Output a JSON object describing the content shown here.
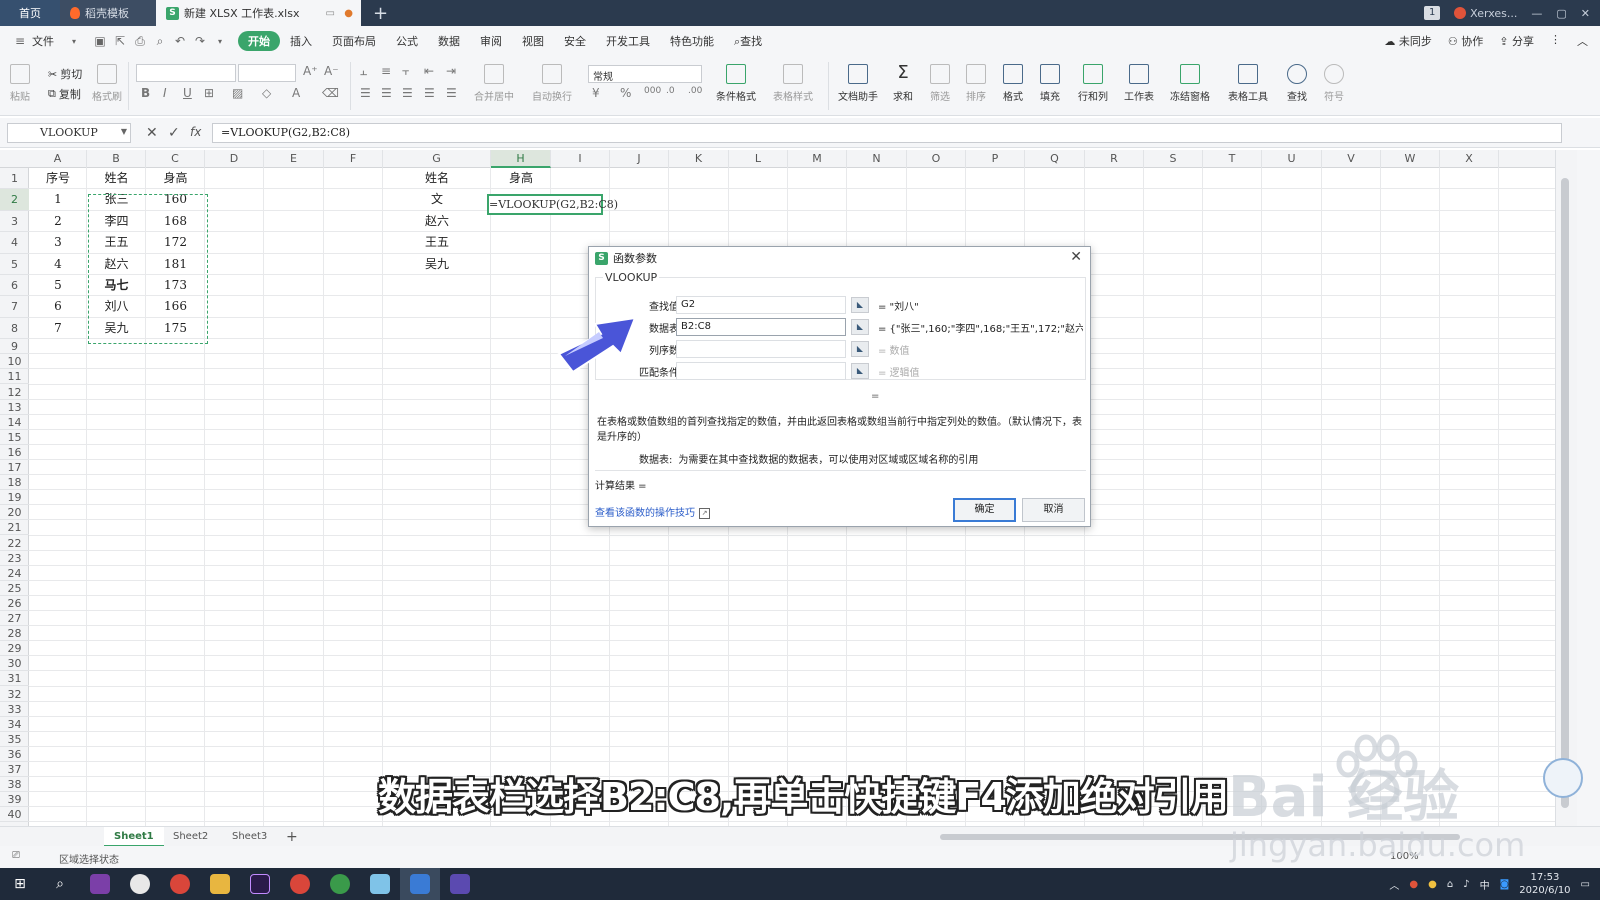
{
  "tabs": {
    "home": "首页",
    "template": "稻壳模板",
    "active_file": "新建 XLSX 工作表.xlsx",
    "badge_count": "1",
    "user_name": "Xerxes..."
  },
  "menu": {
    "file": "文件",
    "items": [
      "开始",
      "插入",
      "页面布局",
      "公式",
      "数据",
      "审阅",
      "视图",
      "安全",
      "开发工具",
      "特色功能"
    ],
    "search": "查找",
    "unsync": "未同步",
    "collab": "协作",
    "share": "分享"
  },
  "ribbon": {
    "paste": "粘贴",
    "cut": "剪切",
    "copy": "复制",
    "format_painter": "格式刷",
    "number_format": "常规",
    "merge_center": "合并居中",
    "wrap": "自动换行",
    "cond_format": "条件格式",
    "table_style": "表格样式",
    "doc_helper": "文档助手",
    "sum": "求和",
    "filter": "筛选",
    "sort": "排序",
    "format": "格式",
    "fill": "填充",
    "row_col": "行和列",
    "worksheet": "工作表",
    "freeze": "冻结窗格",
    "table_tools": "表格工具",
    "find": "查找",
    "symbol": "符号"
  },
  "formula_bar": {
    "name_box": "VLOOKUP",
    "formula": "=VLOOKUP(G2,B2:C8)"
  },
  "grid": {
    "columns": [
      "A",
      "B",
      "C",
      "D",
      "E",
      "F",
      "G",
      "H",
      "I",
      "J",
      "K",
      "L",
      "M",
      "N",
      "O",
      "P",
      "Q",
      "R",
      "S",
      "T",
      "U",
      "V",
      "W",
      "X"
    ],
    "rows": [
      "1",
      "2",
      "3",
      "4",
      "5",
      "6",
      "7",
      "8",
      "9",
      "10",
      "11",
      "12",
      "13",
      "14",
      "15",
      "16",
      "17",
      "18",
      "19",
      "20",
      "21",
      "22",
      "23",
      "24",
      "25",
      "26",
      "27",
      "28",
      "29",
      "30",
      "31",
      "32",
      "33",
      "34",
      "35",
      "36",
      "37",
      "38",
      "39",
      "40"
    ],
    "table_headers": [
      "序号",
      "姓名",
      "身高"
    ],
    "table_rows": [
      [
        "1",
        "张三",
        "160"
      ],
      [
        "2",
        "李四",
        "168"
      ],
      [
        "3",
        "王五",
        "172"
      ],
      [
        "4",
        "赵六",
        "181"
      ],
      [
        "5",
        "马七",
        "173"
      ],
      [
        "6",
        "刘八",
        "166"
      ],
      [
        "7",
        "吴九",
        "175"
      ]
    ],
    "lookup_header_name": "姓名",
    "lookup_header_height": "身高",
    "lookup_names": [
      "文",
      "赵六",
      "王五",
      "吴九"
    ],
    "edit_cell_text": "=VLOOKUP(G2,B2:C8)"
  },
  "sheets": [
    "Sheet1",
    "Sheet2",
    "Sheet3"
  ],
  "status": {
    "mode": "区域选择状态",
    "zoom": "100%"
  },
  "dialog": {
    "title": "函数参数",
    "function_name": "VLOOKUP",
    "args": [
      {
        "label": "查找值",
        "value": "G2",
        "result": "= \"刘八\""
      },
      {
        "label": "数据表",
        "value": "B2:C8",
        "result": "= {\"张三\",160;\"李四\",168;\"王五\",172;\"赵六..."
      },
      {
        "label": "列序数",
        "value": "",
        "result": "= 数值"
      },
      {
        "label": "匹配条件",
        "value": "",
        "result": "= 逻辑值"
      }
    ],
    "equals": "=",
    "description": "在表格或数值数组的首列查找指定的数值，并由此返回表格或数组当前行中指定列处的数值。（默认情况下，表是升序的）",
    "arg_desc_label": "数据表:",
    "arg_desc_text": "为需要在其中查找数据的数据表，可以使用对区域或区域名称的引用",
    "result_label": "计算结果 =",
    "help_link": "查看该函数的操作技巧",
    "ok": "确定",
    "cancel": "取消"
  },
  "overlay": {
    "subtitle": "数据表栏选择B2:C8,再单击快捷键F4添加绝对引用",
    "watermark_brand": "Bai  经验",
    "watermark_url": "jingyan.baidu.com"
  },
  "taskbar": {
    "time": "17:53",
    "date": "2020/6/10",
    "ime": "中"
  },
  "colors": {
    "accent_green": "#3aa56b",
    "title_bar": "#2b3a4e",
    "arrow_blue": "#4a55d8",
    "link_blue": "#2a5cc9"
  }
}
